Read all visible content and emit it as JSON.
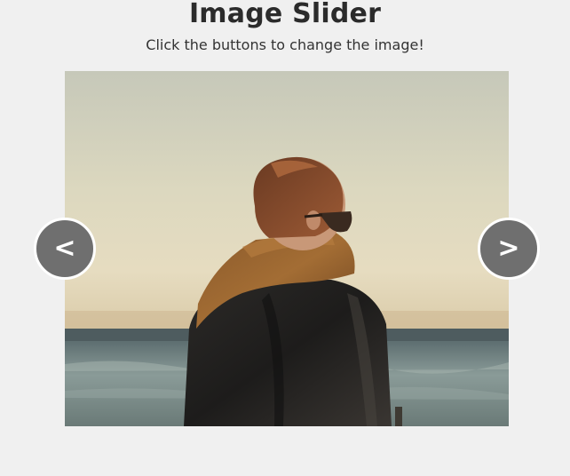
{
  "header": {
    "title": "Image Slider",
    "subtitle": "Click the buttons to change the image!"
  },
  "slider": {
    "prev_label": "<",
    "next_label": ">"
  },
  "colors": {
    "background": "#f0f0f0",
    "button_fill": "#6f6f6f",
    "button_border": "#ffffff"
  }
}
